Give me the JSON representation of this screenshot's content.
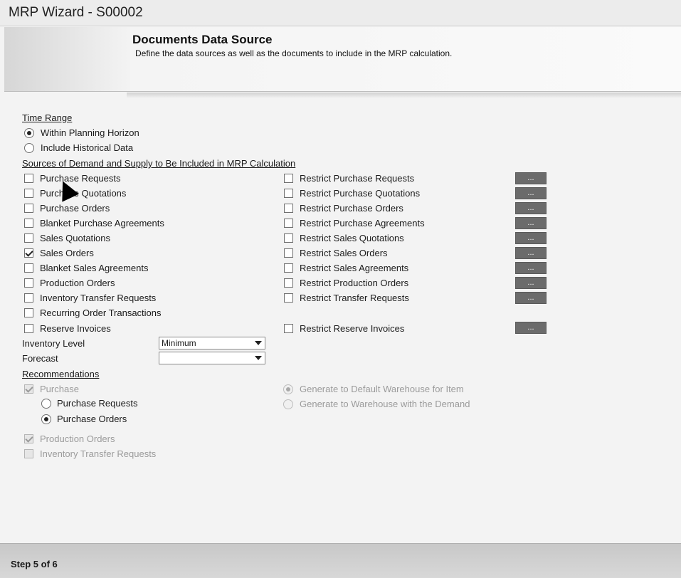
{
  "window": {
    "title": "MRP Wizard - S00002"
  },
  "header": {
    "title": "Documents Data Source",
    "subtitle": "Define the data sources as well as the documents to include in the MRP calculation."
  },
  "time_range": {
    "label": "Time Range",
    "options": [
      {
        "label": "Within Planning Horizon",
        "selected": true
      },
      {
        "label": "Include Historical Data",
        "selected": false
      }
    ]
  },
  "sources": {
    "label": "Sources of Demand and Supply to Be Included in MRP Calculation",
    "items": [
      {
        "label": "Purchase Requests",
        "checked": false,
        "restrict_label": "Restrict Purchase Requests",
        "restrict_checked": false,
        "button_label": "..."
      },
      {
        "label": "Purchase Quotations",
        "checked": false,
        "restrict_label": "Restrict Purchase Quotations",
        "restrict_checked": false,
        "button_label": "..."
      },
      {
        "label": "Purchase Orders",
        "checked": false,
        "restrict_label": "Restrict Purchase Orders",
        "restrict_checked": false,
        "button_label": "..."
      },
      {
        "label": "Blanket Purchase Agreements",
        "checked": false,
        "restrict_label": "Restrict Purchase Agreements",
        "restrict_checked": false,
        "button_label": "..."
      },
      {
        "label": "Sales Quotations",
        "checked": false,
        "restrict_label": "Restrict Sales Quotations",
        "restrict_checked": false,
        "button_label": "..."
      },
      {
        "label": "Sales Orders",
        "checked": true,
        "restrict_label": "Restrict Sales Orders",
        "restrict_checked": false,
        "button_label": "..."
      },
      {
        "label": "Blanket Sales Agreements",
        "checked": false,
        "restrict_label": "Restrict Sales Agreements",
        "restrict_checked": false,
        "button_label": "..."
      },
      {
        "label": "Production Orders",
        "checked": false,
        "restrict_label": "Restrict Production Orders",
        "restrict_checked": false,
        "button_label": "..."
      },
      {
        "label": "Inventory Transfer Requests",
        "checked": false,
        "restrict_label": "Restrict Transfer Requests",
        "restrict_checked": false,
        "button_label": "..."
      },
      {
        "label": "Recurring Order Transactions",
        "checked": false
      },
      {
        "label": "Reserve Invoices",
        "checked": false,
        "restrict_label": "Restrict Reserve Invoices",
        "restrict_checked": false,
        "button_label": "..."
      }
    ]
  },
  "inventory_level": {
    "label": "Inventory Level",
    "value": "Minimum"
  },
  "forecast": {
    "label": "Forecast",
    "value": ""
  },
  "recommendations": {
    "label": "Recommendations",
    "purchase": {
      "label": "Purchase",
      "checked": true,
      "disabled": true
    },
    "purchase_options": [
      {
        "label": "Purchase Requests",
        "selected": false
      },
      {
        "label": "Purchase Orders",
        "selected": true
      }
    ],
    "warehouse_options": [
      {
        "label": "Generate to Default Warehouse for Item",
        "selected": true,
        "disabled": true
      },
      {
        "label": "Generate to Warehouse with the Demand",
        "selected": false,
        "disabled": true
      }
    ],
    "production_orders": {
      "label": "Production Orders",
      "checked": true,
      "disabled": true
    },
    "inventory_transfer_requests": {
      "label": "Inventory Transfer Requests",
      "checked": false,
      "disabled": true
    }
  },
  "footer": {
    "step": "Step 5 of 6"
  }
}
